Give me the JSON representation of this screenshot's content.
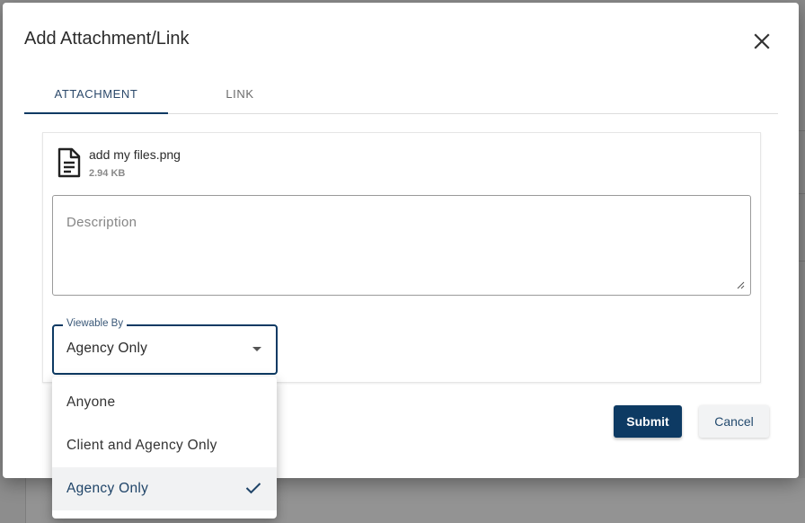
{
  "dialog": {
    "title": "Add Attachment/Link",
    "close_icon": "close-icon"
  },
  "tabs": [
    {
      "label": "ATTACHMENT",
      "active": true
    },
    {
      "label": "LINK",
      "active": false
    }
  ],
  "attachment": {
    "file_icon": "file-document-icon",
    "file_name": "add my files.png",
    "file_size": "2.94 KB",
    "description": {
      "value": "",
      "placeholder": "Description"
    },
    "viewable_by": {
      "label": "Viewable By",
      "selected": "Agency Only",
      "options": [
        "Anyone",
        "Client and Agency Only",
        "Agency Only"
      ]
    }
  },
  "actions": {
    "submit_label": "Submit",
    "cancel_label": "Cancel"
  },
  "colors": {
    "primary": "#0d3a63",
    "overlay": "#8d8d8d",
    "selected_row": "#f1f2f3"
  }
}
